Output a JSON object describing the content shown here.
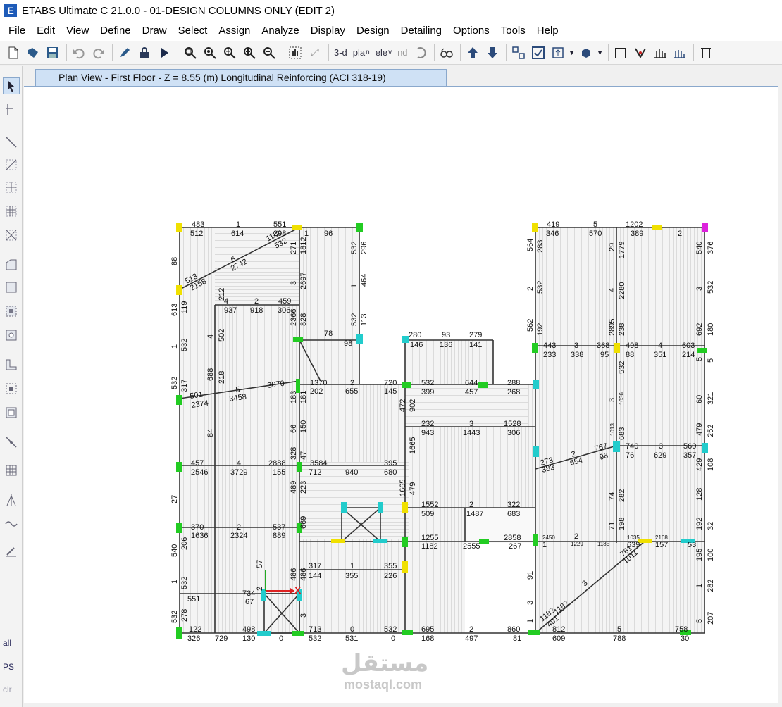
{
  "window": {
    "title": "ETABS Ultimate C 21.0.0 - 01-DESIGN COLUMNS ONLY (EDIT 2)",
    "logo_letter": "E"
  },
  "menu": [
    "File",
    "Edit",
    "View",
    "Define",
    "Draw",
    "Select",
    "Assign",
    "Analyze",
    "Display",
    "Design",
    "Detailing",
    "Options",
    "Tools",
    "Help"
  ],
  "toolbar": {
    "view_3d": "3-d",
    "view_plan": "pl a\nn",
    "view_elev": "el e\nv",
    "view_nd": "nd"
  },
  "left_toolbar": {
    "all": "all",
    "ps": "PS",
    "clr": "clr"
  },
  "tab": {
    "label": "Plan View - First Floor - Z = 8.55 (m)  Longitudinal Reinforcing  (ACI 318-19)"
  },
  "labels": {
    "a1": "483",
    "a2": "1",
    "a3": "551",
    "a4": "512",
    "a5": "614",
    "a6": "298",
    "a7": "1",
    "a8": "96",
    "a9": "419",
    "a10": "5",
    "a11": "1202",
    "a12": "346",
    "a13": "570",
    "a14": "389",
    "a15": "2",
    "b1": "513",
    "b2": "2158",
    "b3": "6",
    "b4": "2742",
    "b5": "532",
    "b6": "1186",
    "b7": "4",
    "b8": "2",
    "b9": "459",
    "b10": "937",
    "b11": "918",
    "b12": "306",
    "c1": "78",
    "c2": "98",
    "c3": "280",
    "c4": "93",
    "c5": "279",
    "c6": "146",
    "c7": "136",
    "c8": "141",
    "c9": "443",
    "c10": "3",
    "c11": "368",
    "c12": "498",
    "c13": "4",
    "c14": "603",
    "c15": "233",
    "c16": "338",
    "c17": "95",
    "c18": "88",
    "c19": "351",
    "c20": "214",
    "d1": "3070",
    "d2": "501",
    "d3": "5",
    "d4": "2374",
    "d5": "3458",
    "d6": "1370",
    "d7": "2",
    "d8": "720",
    "d9": "202",
    "d10": "655",
    "d11": "145",
    "d12": "532",
    "d13": "644",
    "d14": "288",
    "d15": "399",
    "d16": "457",
    "d17": "268",
    "e1": "232",
    "e2": "3",
    "e3": "1528",
    "e4": "943",
    "e5": "1443",
    "e6": "306",
    "f1": "457",
    "f2": "4",
    "f3": "2888",
    "f4": "3584",
    "f5": "395",
    "f6": "2546",
    "f7": "3729",
    "f8": "155",
    "f9": "712",
    "f10": "940",
    "f11": "680",
    "f12": "273",
    "f13": "2",
    "f14": "767",
    "f15": "740",
    "f16": "3",
    "f17": "560",
    "f18": "383",
    "f19": "654",
    "f20": "96",
    "f21": "76",
    "f22": "629",
    "f23": "357",
    "g1": "1552",
    "g2": "2",
    "g3": "322",
    "g4": "509",
    "g5": "1487",
    "g6": "683",
    "g7": "370",
    "g8": "2",
    "g9": "537",
    "g10": "1636",
    "g11": "2324",
    "g12": "889",
    "g13": "1255",
    "g14": "2858",
    "g15": "1182",
    "g16": "2555",
    "g17": "267",
    "g18": "2450",
    "g19": "2",
    "g20": "1",
    "g21": "1229",
    "g22": "1185",
    "g23": "1035",
    "g24": "2168",
    "g25": "639",
    "g26": "157",
    "g27": "53",
    "h1": "317",
    "h2": "1",
    "h3": "355",
    "h4": "144",
    "h5": "355",
    "h6": "226",
    "h7": "734",
    "h8": "551",
    "h9": "67",
    "h10": "1182",
    "h11": "3",
    "h12": "761",
    "h13": "1011",
    "i1": "122",
    "i2": "498",
    "i3": "713",
    "i4": "0",
    "i5": "532",
    "i6": "695",
    "i7": "2",
    "i8": "860",
    "i9": "326",
    "i10": "729",
    "i11": "130",
    "i12": "0",
    "i13": "532",
    "i14": "531",
    "i15": "0",
    "i16": "168",
    "i17": "497",
    "i18": "81",
    "i19": "812",
    "i20": "5",
    "i21": "758",
    "i22": "609",
    "i23": "788",
    "i24": "30",
    "i25": "1182",
    "i26": "401",
    "v1": "88",
    "v2": "613",
    "v3": "1",
    "v4": "532",
    "v5": "540",
    "v6": "1",
    "v7": "532",
    "v8": "27",
    "v9": "119",
    "v10": "532",
    "v11": "317",
    "v12": "206",
    "v13": "532",
    "v14": "278",
    "v15": "212",
    "v16": "4",
    "v17": "502",
    "v18": "688",
    "v19": "218",
    "v20": "84",
    "v21": "564",
    "v22": "2",
    "v23": "562",
    "v24": "283",
    "v25": "532",
    "v26": "192",
    "v27": "540",
    "v28": "3",
    "v29": "692",
    "v30": "5",
    "v31": "60",
    "v32": "479",
    "v33": "429",
    "v34": "128",
    "v35": "192",
    "v36": "195",
    "v37": "1",
    "v38": "5",
    "v39": "376",
    "v40": "532",
    "v41": "180",
    "v42": "5",
    "v43": "321",
    "v44": "252",
    "v45": "108",
    "v46": "100",
    "v47": "32",
    "v48": "282",
    "v49": "207",
    "v50": "29",
    "v51": "1779",
    "v52": "4",
    "v53": "2280",
    "v54": "2895",
    "v55": "238",
    "v56": "532",
    "v57": "3",
    "v58": "1036",
    "v59": "1013",
    "v60": "683",
    "v61": "74",
    "v62": "282",
    "v63": "71",
    "v64": "198",
    "v65": "532",
    "v66": "296",
    "v67": "1",
    "v68": "464",
    "v69": "532",
    "v70": "113",
    "v71": "3",
    "v72": "2697",
    "v73": "2366",
    "v74": "828",
    "v75": "271",
    "v76": "1812",
    "v77": "472",
    "v78": "902",
    "v79": "1665",
    "v80": "1665",
    "v81": "479",
    "v82": "91",
    "v83": "3",
    "v84": "1",
    "v85": "486",
    "v86": "486",
    "v87": "489",
    "v88": "223",
    "v89": "669",
    "v90": "66",
    "v91": "150",
    "v92": "183",
    "v93": "181",
    "v94": "328",
    "v95": "47",
    "v96": "57",
    "v97": "2",
    "v98": "3"
  }
}
